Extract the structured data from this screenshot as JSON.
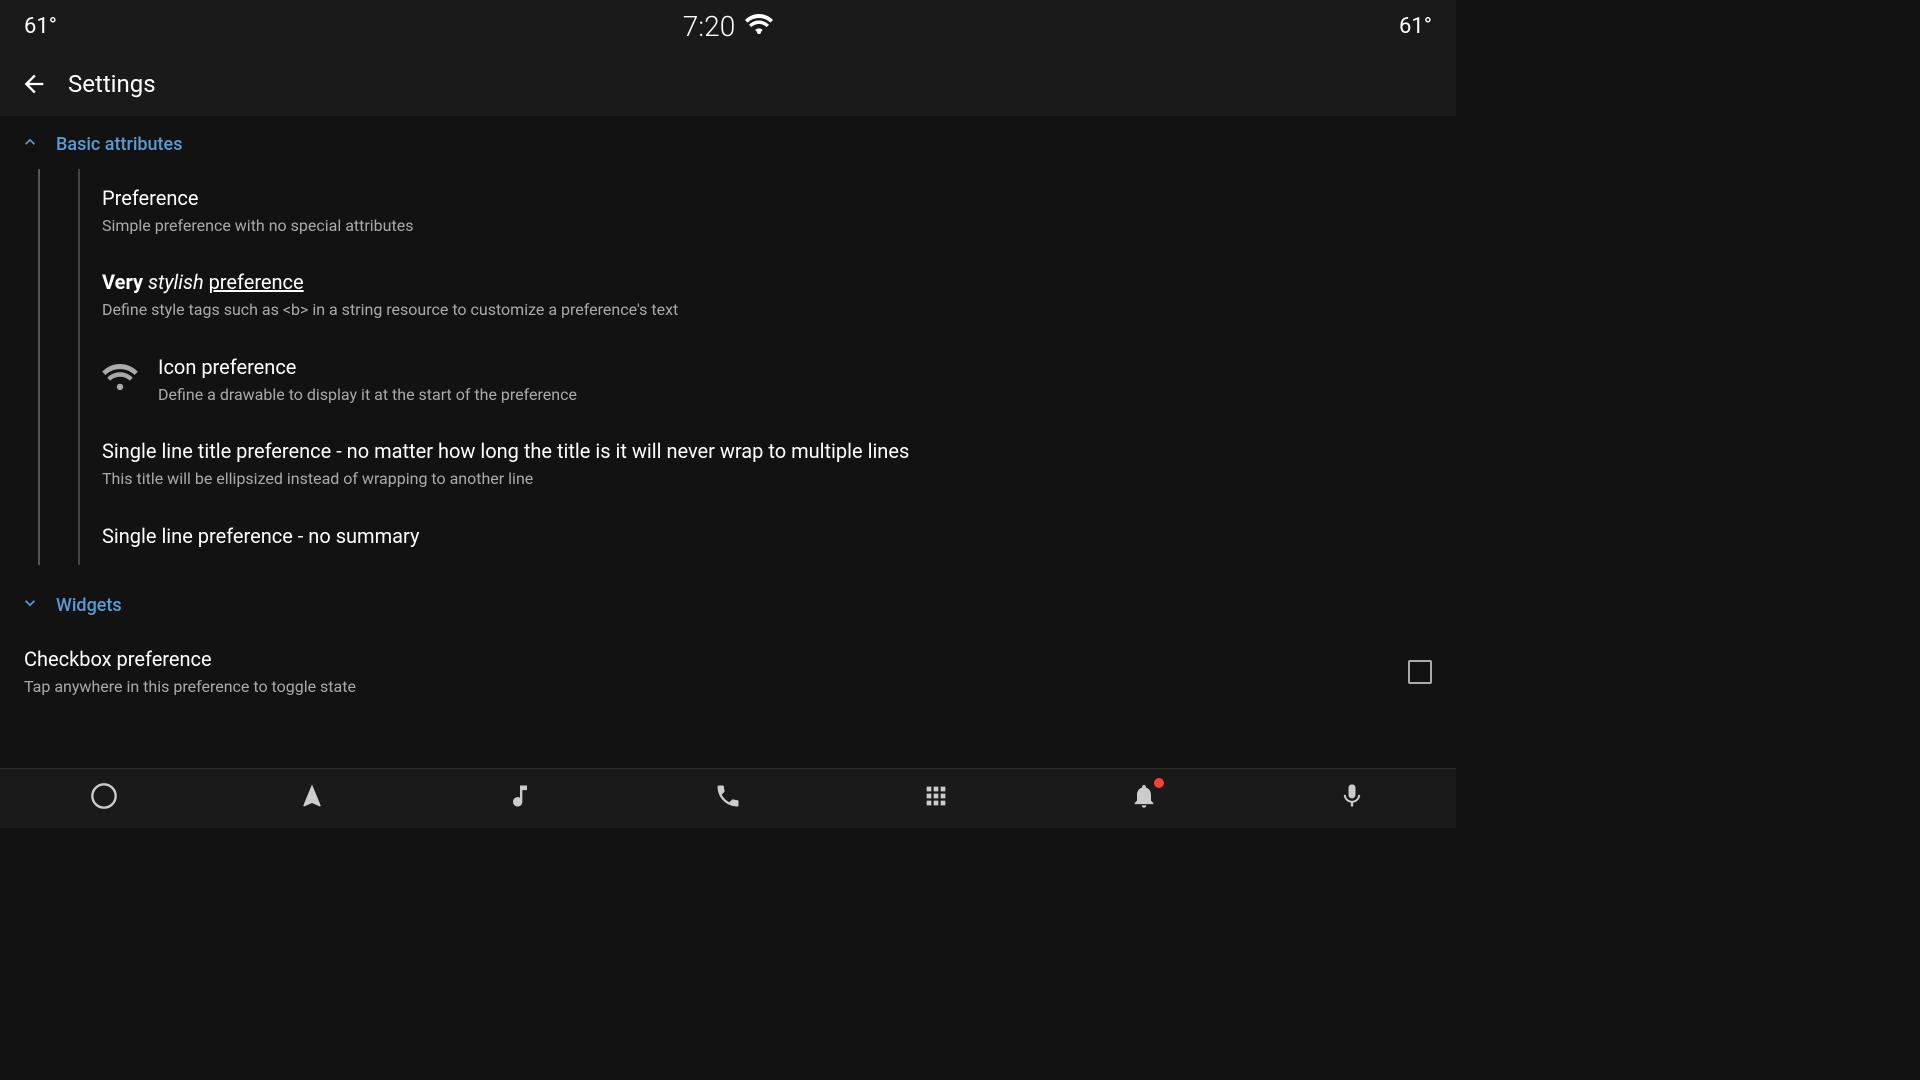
{
  "statusBar": {
    "tempLeft": "61°",
    "time": "7:20",
    "tempRight": "61°"
  },
  "appBar": {
    "title": "Settings",
    "backLabel": "←"
  },
  "sections": [
    {
      "id": "basic-attributes",
      "title": "Basic attributes",
      "chevron": "chevron-up",
      "expanded": true,
      "items": [
        {
          "id": "preference",
          "title": "Preference",
          "titleFormatted": false,
          "summary": "Simple preference with no special attributes",
          "hasIcon": false,
          "widget": null
        },
        {
          "id": "stylish-preference",
          "title": "Very stylish preference",
          "titleFormatted": true,
          "summary": "Define style tags such as <b> in a string resource to customize a preference's text",
          "hasIcon": false,
          "widget": null
        },
        {
          "id": "icon-preference",
          "title": "Icon preference",
          "titleFormatted": false,
          "summary": "Define a drawable to display it at the start of the preference",
          "hasIcon": true,
          "widget": null
        },
        {
          "id": "single-line-title",
          "title": "Single line title preference - no matter how long the title is it will never wrap to multiple lines",
          "titleFormatted": false,
          "summary": "This title will be ellipsized instead of wrapping to another line",
          "hasIcon": false,
          "widget": null
        },
        {
          "id": "single-line-no-summary",
          "title": "Single line preference - no summary",
          "titleFormatted": false,
          "summary": "",
          "hasIcon": false,
          "widget": null
        }
      ]
    },
    {
      "id": "widgets",
      "title": "Widgets",
      "chevron": "chevron-down",
      "expanded": false,
      "items": [
        {
          "id": "checkbox-preference",
          "title": "Checkbox preference",
          "titleFormatted": false,
          "summary": "Tap anywhere in this preference to toggle state",
          "hasIcon": false,
          "widget": "checkbox"
        }
      ]
    }
  ],
  "bottomNav": {
    "items": [
      {
        "id": "home",
        "icon": "circle",
        "label": "Home"
      },
      {
        "id": "navigation",
        "icon": "directions",
        "label": "Navigation"
      },
      {
        "id": "music",
        "icon": "music-note",
        "label": "Music"
      },
      {
        "id": "phone",
        "icon": "phone",
        "label": "Phone"
      },
      {
        "id": "apps",
        "icon": "apps",
        "label": "Apps"
      },
      {
        "id": "notifications",
        "icon": "bell",
        "label": "Notifications",
        "hasDot": true
      },
      {
        "id": "microphone",
        "icon": "mic",
        "label": "Microphone"
      }
    ]
  }
}
